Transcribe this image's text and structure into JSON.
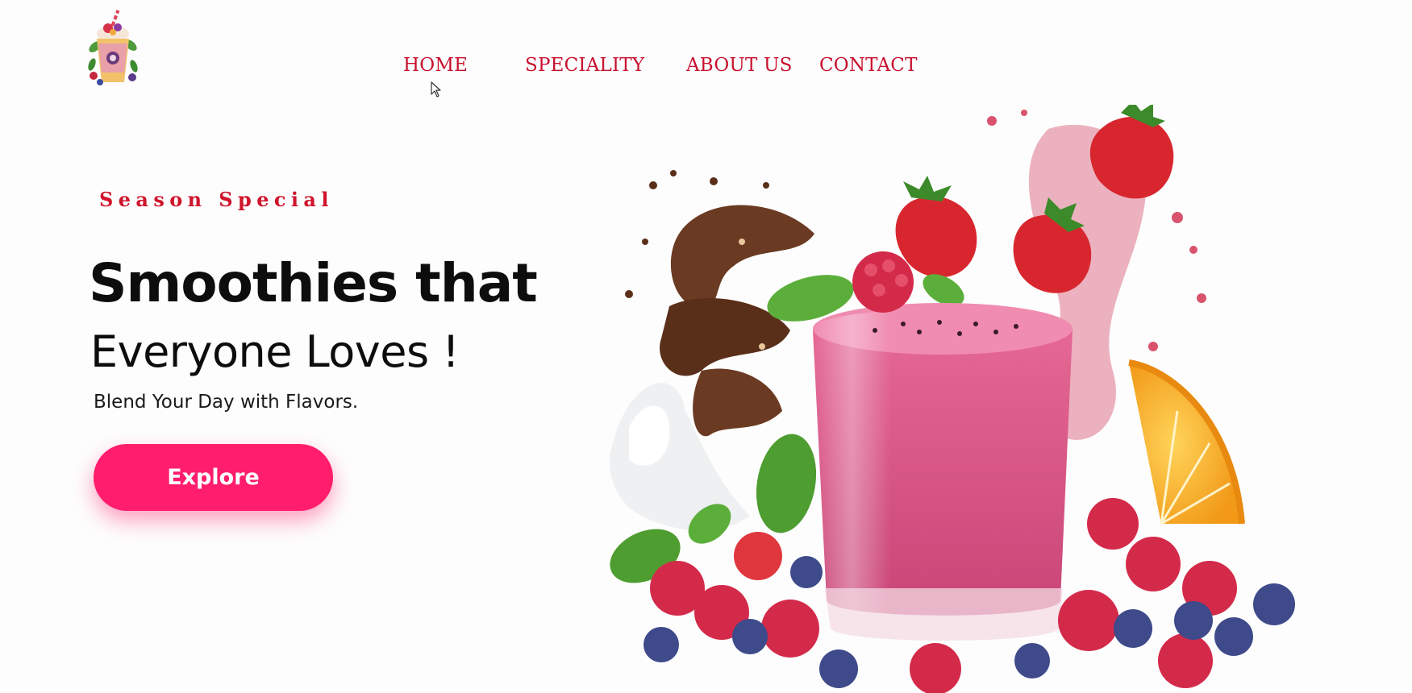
{
  "brand": {
    "logo_icon": "smoothie-cup-logo-icon"
  },
  "nav": {
    "items": [
      {
        "label": "HOME",
        "active": true
      },
      {
        "label": "SPECIALITY",
        "active": false
      },
      {
        "label": "ABOUT US",
        "active": false
      },
      {
        "label": "CONTACT",
        "active": false
      }
    ],
    "color": "#c8102e"
  },
  "hero": {
    "eyebrow": "Season Special",
    "headline_line1": "Smoothies that",
    "headline_line2": "Everyone Loves !",
    "tagline": "Blend Your Day with Flavors.",
    "cta_label": "Explore",
    "cta_color": "#ff1d6c",
    "illustration_icon": "berry-smoothie-glass-illustration"
  }
}
